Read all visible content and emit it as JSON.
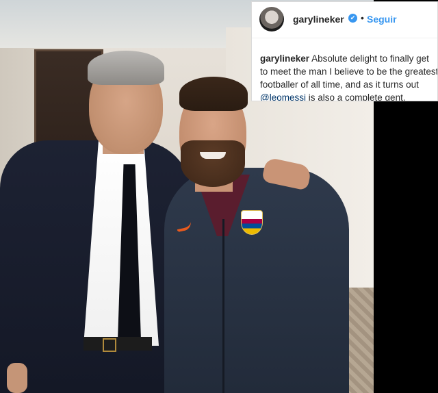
{
  "post": {
    "username": "garylineker",
    "verified_mark": "✔",
    "separator": "•",
    "follow_label": "Seguir",
    "caption_user": "garylineker",
    "caption_line1": "Absolute delight to finally get",
    "caption_line2": "to meet the man I believe to be the greatest",
    "caption_line3": "footballer of all time, and as it turns out",
    "caption_mention": "@leomessi",
    "caption_line4_rest": "is also a complete gent.",
    "avatar_icon": "profile-avatar-icon",
    "accent_color": "#3897f0"
  }
}
